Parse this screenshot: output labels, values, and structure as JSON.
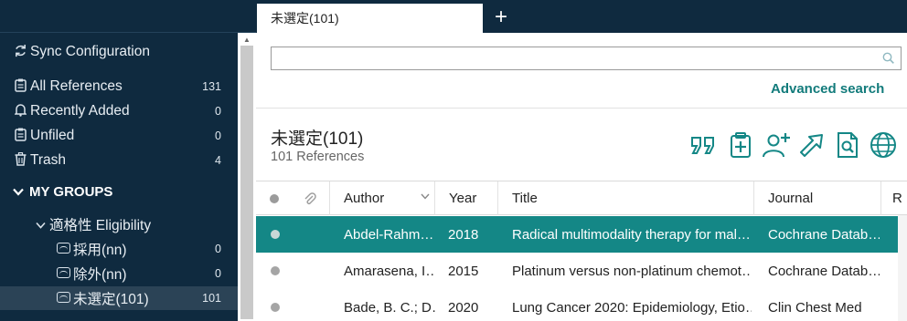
{
  "tab": {
    "label": "未選定(101)",
    "add_label": "+"
  },
  "sidebar": {
    "sync_label": "Sync Configuration",
    "library": [
      {
        "icon": "clipboard-icon",
        "label": "All References",
        "count": "131"
      },
      {
        "icon": "bell-icon",
        "label": "Recently Added",
        "count": "0"
      },
      {
        "icon": "clipboard-icon",
        "label": "Unfiled",
        "count": "0"
      },
      {
        "icon": "trash-icon",
        "label": "Trash",
        "count": "4"
      }
    ],
    "groups_heading": "MY GROUPS",
    "group": {
      "label": "適格性 Eligibility"
    },
    "group_items": [
      {
        "icon": "group-box-icon",
        "label": "採用(nn)",
        "count": "0"
      },
      {
        "icon": "group-box-icon",
        "label": "除外(nn)",
        "count": "0"
      },
      {
        "icon": "group-box-icon",
        "label": "未選定(101)",
        "count": "101"
      }
    ]
  },
  "search": {
    "value": "",
    "placeholder": "",
    "advanced_label": "Advanced search"
  },
  "collection": {
    "title": "未選定(101)",
    "count_text": "101 References"
  },
  "toolbar": {
    "icons": [
      "cite-quote-icon",
      "add-to-clipboard-icon",
      "add-user-icon",
      "share-export-icon",
      "find-pdf-icon",
      "online-search-globe-icon"
    ],
    "color": "#148786"
  },
  "table": {
    "columns": [
      "Author",
      "Year",
      "Title",
      "Journal",
      "R"
    ],
    "rows": [
      {
        "author": "Abdel-Rahm…",
        "year": "2018",
        "title": "Radical multimodality therapy for mal…",
        "journal": "Cochrane Datab…",
        "selected": true
      },
      {
        "author": "Amarasena, I…",
        "year": "2015",
        "title": "Platinum versus non-platinum chemot…",
        "journal": "Cochrane Datab…",
        "selected": false
      },
      {
        "author": "Bade, B. C.; D…",
        "year": "2020",
        "title": "Lung Cancer 2020: Epidemiology, Etio…",
        "journal": "Clin Chest Med",
        "selected": false
      }
    ]
  },
  "colors": {
    "sidebar_bg": "#0f2a3f",
    "selected_row": "#148786",
    "accent": "#127b7b"
  }
}
